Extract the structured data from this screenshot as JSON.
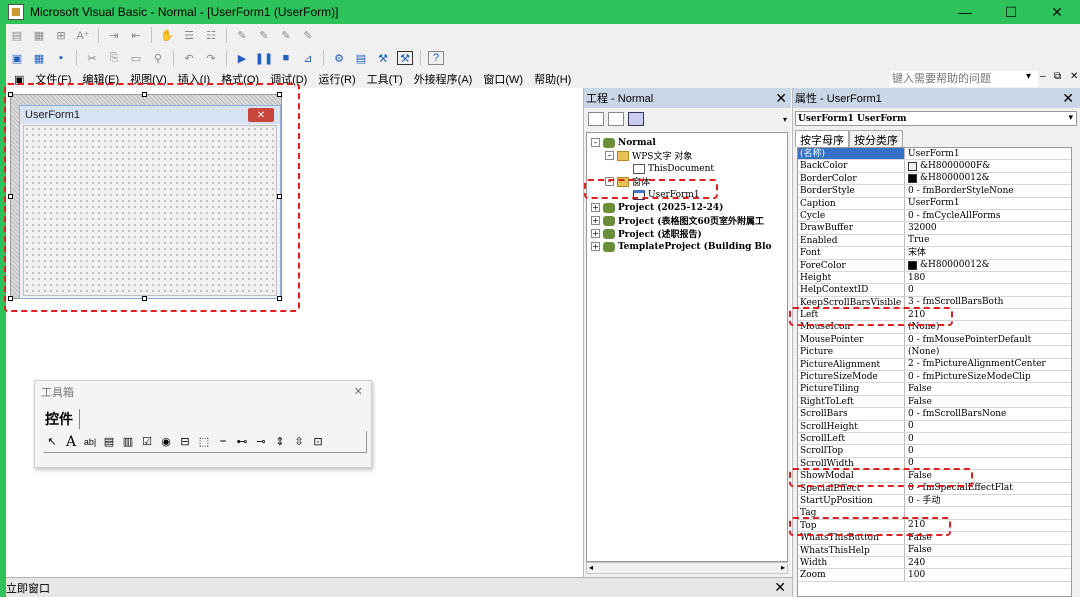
{
  "window": {
    "title": "Microsoft Visual Basic - Normal - [UserForm1 (UserForm)]",
    "minimize": "—",
    "maximize": "☐",
    "close": "✕"
  },
  "menu": {
    "items": [
      "文件(F)",
      "编辑(E)",
      "视图(V)",
      "插入(I)",
      "格式(O)",
      "调试(D)",
      "运行(R)",
      "工具(T)",
      "外接程序(A)",
      "窗口(W)",
      "帮助(H)"
    ],
    "help_placeholder": "键入需要帮助的问题"
  },
  "design": {
    "form_caption": "UserForm1",
    "form_close": "✕"
  },
  "toolbox": {
    "title": "工具箱",
    "tab": "控件",
    "tools": [
      "↖",
      "A",
      "ab|",
      "▤",
      "▥",
      "☑",
      "◉",
      "⊟",
      "⬚",
      "⎯",
      "⊷",
      "⊸",
      "⇕",
      "⇳",
      "⊡"
    ]
  },
  "immediate": {
    "title": "立即窗口"
  },
  "project": {
    "title": "工程 - Normal",
    "tree": [
      {
        "label": "Normal",
        "bold": true
      },
      {
        "label": "WPS文字 对象",
        "bold": false
      },
      {
        "label": "ThisDocument",
        "bold": false
      },
      {
        "label": "窗体",
        "bold": false
      },
      {
        "label": "UserForm1",
        "bold": false
      },
      {
        "label": "Project (2025-12-24)",
        "bold": true
      },
      {
        "label": "Project (表格图文60页室外附属工",
        "bold": true
      },
      {
        "label": "Project (述职报告)",
        "bold": true
      },
      {
        "label": "TemplateProject (Building Blo",
        "bold": true
      }
    ]
  },
  "properties": {
    "title": "属性 - UserForm1",
    "object": "UserForm1 UserForm",
    "tabs": [
      "按字母序",
      "按分类序"
    ],
    "rows": [
      {
        "name": "(名称)",
        "value": "UserForm1"
      },
      {
        "name": "BackColor",
        "value": "&H8000000F&",
        "swatch": "#f0f0f0"
      },
      {
        "name": "BorderColor",
        "value": "&H80000012&",
        "swatch": "#000000"
      },
      {
        "name": "BorderStyle",
        "value": "0 - fmBorderStyleNone"
      },
      {
        "name": "Caption",
        "value": "UserForm1"
      },
      {
        "name": "Cycle",
        "value": "0 - fmCycleAllForms"
      },
      {
        "name": "DrawBuffer",
        "value": "32000"
      },
      {
        "name": "Enabled",
        "value": "True"
      },
      {
        "name": "Font",
        "value": "宋体"
      },
      {
        "name": "ForeColor",
        "value": "&H80000012&",
        "swatch": "#000000"
      },
      {
        "name": "Height",
        "value": "180"
      },
      {
        "name": "HelpContextID",
        "value": "0"
      },
      {
        "name": "KeepScrollBarsVisible",
        "value": "3 - fmScrollBarsBoth"
      },
      {
        "name": "Left",
        "value": "210"
      },
      {
        "name": "MouseIcon",
        "value": "(None)"
      },
      {
        "name": "MousePointer",
        "value": "0 - fmMousePointerDefault"
      },
      {
        "name": "Picture",
        "value": "(None)"
      },
      {
        "name": "PictureAlignment",
        "value": "2 - fmPictureAlignmentCenter"
      },
      {
        "name": "PictureSizeMode",
        "value": "0 - fmPictureSizeModeClip"
      },
      {
        "name": "PictureTiling",
        "value": "False"
      },
      {
        "name": "RightToLeft",
        "value": "False"
      },
      {
        "name": "ScrollBars",
        "value": "0 - fmScrollBarsNone"
      },
      {
        "name": "ScrollHeight",
        "value": "0"
      },
      {
        "name": "ScrollLeft",
        "value": "0"
      },
      {
        "name": "ScrollTop",
        "value": "0"
      },
      {
        "name": "ScrollWidth",
        "value": "0"
      },
      {
        "name": "ShowModal",
        "value": "False"
      },
      {
        "name": "SpecialEffect",
        "value": "0 - fmSpecialEffectFlat"
      },
      {
        "name": "StartUpPosition",
        "value": "0 - 手动"
      },
      {
        "name": "Tag",
        "value": ""
      },
      {
        "name": "Top",
        "value": "210"
      },
      {
        "name": "WhatsThisButton",
        "value": "False"
      },
      {
        "name": "WhatsThisHelp",
        "value": "False"
      },
      {
        "name": "Width",
        "value": "240"
      },
      {
        "name": "Zoom",
        "value": "100"
      }
    ]
  },
  "colors": {
    "titlebar": "#2ec25a",
    "annotation": "#e02020",
    "selection": "#3470c8"
  }
}
